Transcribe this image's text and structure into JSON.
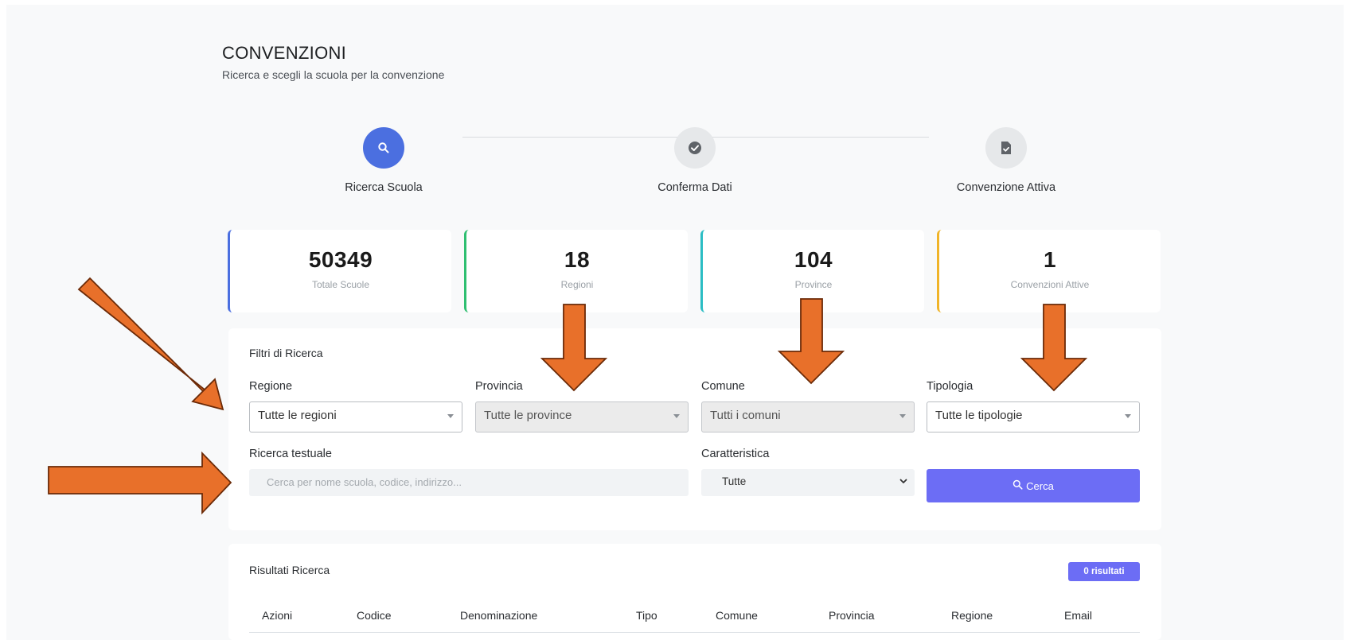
{
  "header": {
    "title": "CONVENZIONI",
    "subtitle": "Ricerca e scegli la scuola per la convenzione"
  },
  "stepper": [
    {
      "label": "Ricerca Scuola",
      "icon": "search-icon",
      "state": "active"
    },
    {
      "label": "Conferma Dati",
      "icon": "check-circle-icon",
      "state": "inactive"
    },
    {
      "label": "Convenzione Attiva",
      "icon": "file-check-icon",
      "state": "inactive"
    }
  ],
  "stats": [
    {
      "value": "50349",
      "label": "Totale Scuole",
      "accent": "#4b6fe0"
    },
    {
      "value": "18",
      "label": "Regioni",
      "accent": "#2fbf71"
    },
    {
      "value": "104",
      "label": "Province",
      "accent": "#2bbdc4"
    },
    {
      "value": "1",
      "label": "Convenzioni Attive",
      "accent": "#f0b429"
    }
  ],
  "filters": {
    "title": "Filtri di Ricerca",
    "regione": {
      "label": "Regione",
      "value": "Tutte le regioni"
    },
    "provincia": {
      "label": "Provincia",
      "value": "Tutte le province"
    },
    "comune": {
      "label": "Comune",
      "value": "Tutti i comuni"
    },
    "tipologia": {
      "label": "Tipologia",
      "value": "Tutte le tipologie"
    },
    "ricerca": {
      "label": "Ricerca testuale",
      "placeholder": "Cerca per nome scuola, codice, indirizzo..."
    },
    "caratteristica": {
      "label": "Caratteristica",
      "value": "Tutte"
    },
    "search_button": "Cerca"
  },
  "results": {
    "title": "Risultati Ricerca",
    "badge": "0 risultati",
    "columns": [
      "Azioni",
      "Codice",
      "Denominazione",
      "Tipo",
      "Comune",
      "Provincia",
      "Regione",
      "Email"
    ]
  },
  "colors": {
    "primary": "#4b6fe0",
    "button": "#6c6df5",
    "annotation_arrow": "#e8702a"
  }
}
